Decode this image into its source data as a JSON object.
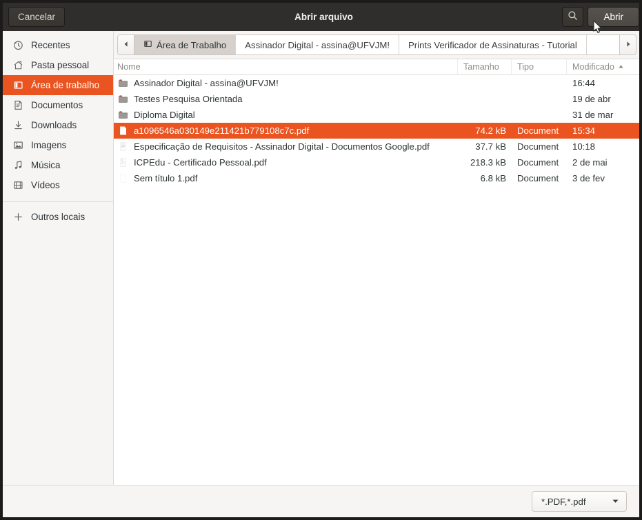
{
  "window": {
    "title": "Abrir arquivo",
    "cancel_label": "Cancelar",
    "open_label": "Abrir",
    "search_icon": "search-icon"
  },
  "accent_color": "#e95420",
  "sidebar": {
    "items": [
      {
        "label": "Recentes",
        "icon": "clock-icon",
        "active": false
      },
      {
        "label": "Pasta pessoal",
        "icon": "home-icon",
        "active": false
      },
      {
        "label": "Área de trabalho",
        "icon": "desktop-icon",
        "active": true
      },
      {
        "label": "Documentos",
        "icon": "document-icon",
        "active": false
      },
      {
        "label": "Downloads",
        "icon": "download-icon",
        "active": false
      },
      {
        "label": "Imagens",
        "icon": "image-icon",
        "active": false
      },
      {
        "label": "Música",
        "icon": "music-icon",
        "active": false
      },
      {
        "label": "Vídeos",
        "icon": "video-icon",
        "active": false
      }
    ],
    "other": {
      "label": "Outros locais",
      "icon": "plus-icon"
    }
  },
  "pathbar": {
    "prev_icon": "chevron-left-icon",
    "next_icon": "chevron-right-icon",
    "crumbs": [
      {
        "label": "Área de Trabalho",
        "icon": "desktop-icon",
        "current": true
      },
      {
        "label": "Assinador Digital - assina@UFVJM!",
        "current": false
      },
      {
        "label": "Prints Verificador de Assinaturas - Tutorial",
        "current": false
      }
    ]
  },
  "columns": {
    "name": "Nome",
    "size": "Tamanho",
    "type": "Tipo",
    "modified": "Modificado",
    "sort_icon": "sort-ascending-icon"
  },
  "files": [
    {
      "name": "Assinador Digital - assina@UFVJM!",
      "size": "",
      "type": "",
      "modified": "16:44",
      "icon": "folder-icon",
      "selected": false
    },
    {
      "name": "Testes Pesquisa Orientada",
      "size": "",
      "type": "",
      "modified": "19 de abr",
      "icon": "folder-icon",
      "selected": false
    },
    {
      "name": "Diploma Digital",
      "size": "",
      "type": "",
      "modified": "31 de mar",
      "icon": "folder-icon",
      "selected": false
    },
    {
      "name": "a1096546a030149e211421b779108c7c.pdf",
      "size": "74.2 kB",
      "type": "Document",
      "modified": "15:34",
      "icon": "pdf-blank-icon",
      "selected": true
    },
    {
      "name": "Especificação de Requisitos - Assinador Digital - Documentos Google.pdf",
      "size": "37.7 kB",
      "type": "Document",
      "modified": "10:18",
      "icon": "pdf-thumb-icon",
      "selected": false
    },
    {
      "name": "ICPEdu - Certificado Pessoal.pdf",
      "size": "218.3 kB",
      "type": "Document",
      "modified": "2 de mai",
      "icon": "pdf-thumb-icon",
      "selected": false
    },
    {
      "name": "Sem título 1.pdf",
      "size": "6.8 kB",
      "type": "Document",
      "modified": "3 de fev",
      "icon": "pdf-plain-icon",
      "selected": false
    }
  ],
  "footer": {
    "filter_value": "*.PDF,*.pdf",
    "dropdown_icon": "chevron-down-icon"
  }
}
